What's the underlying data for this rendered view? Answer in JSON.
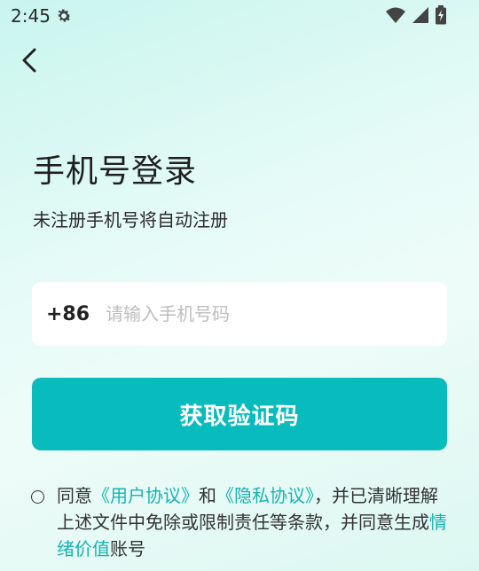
{
  "status_bar": {
    "time": "2:45",
    "icons": [
      "gear-icon",
      "wifi-icon",
      "signal-icon",
      "battery-icon"
    ]
  },
  "nav": {
    "back_icon": "chevron-left-icon"
  },
  "login": {
    "title": "手机号登录",
    "subtitle": "未注册手机号将自动注册",
    "country_code": "+86",
    "phone_placeholder": "请输入手机号码",
    "phone_value": "",
    "submit_label": "获取验证码"
  },
  "agreement": {
    "text_agree": "同意",
    "user_agreement": "《用户协议》",
    "and": "和",
    "privacy_agreement": "《隐私协议》",
    "tail": "，并已清晰理解上述文件中免除或限制责任等条款，并同意生成",
    "account_link": "情绪价值",
    "suffix": "账号"
  },
  "colors": {
    "accent": "#08BCBD",
    "link": "#17B3B3",
    "background": "#E6FBF7"
  }
}
